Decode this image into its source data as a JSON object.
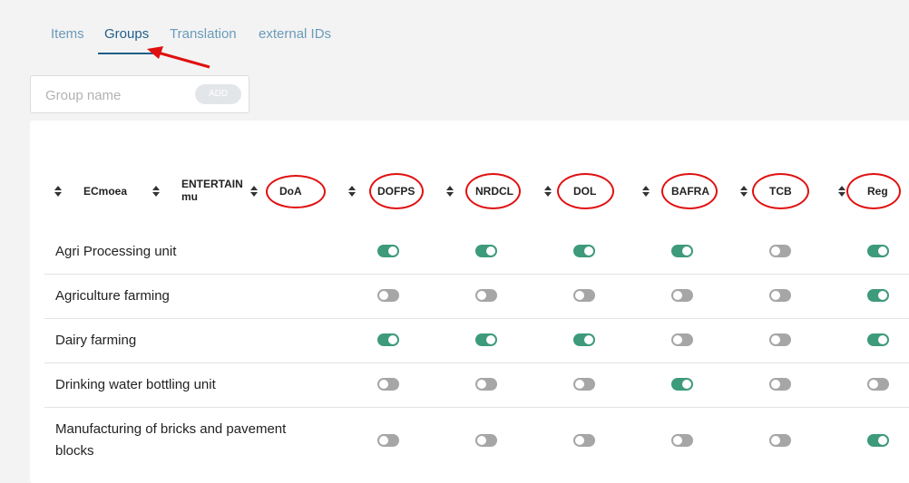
{
  "tabs": [
    {
      "label": "Items"
    },
    {
      "label": "Groups"
    },
    {
      "label": "Translation"
    },
    {
      "label": "external IDs"
    }
  ],
  "active_tab": "Groups",
  "group_form": {
    "placeholder": "Group name",
    "value": "",
    "add_label": "ADD"
  },
  "columns": [
    {
      "label": "ECmoea"
    },
    {
      "label": "ENTERTAIN mu",
      "line1": "ENTERTAIN",
      "line2": "mu"
    },
    {
      "label": "DoA"
    },
    {
      "label": "DOFPS"
    },
    {
      "label": "NRDCL"
    },
    {
      "label": "DOL"
    },
    {
      "label": "BAFRA"
    },
    {
      "label": "TCB"
    },
    {
      "label": "Reg"
    }
  ],
  "rows": [
    {
      "label": "Agri Processing unit",
      "toggles": [
        true,
        true,
        true,
        true,
        false,
        true
      ]
    },
    {
      "label": "Agriculture farming",
      "toggles": [
        false,
        false,
        false,
        false,
        false,
        true
      ]
    },
    {
      "label": "Dairy farming",
      "toggles": [
        true,
        true,
        true,
        false,
        false,
        true
      ]
    },
    {
      "label": "Drinking water bottling unit",
      "toggles": [
        false,
        false,
        false,
        true,
        false,
        false
      ]
    },
    {
      "label": "Manufacturing of bricks and pavement blocks",
      "line1": "Manufacturing of bricks and pavement",
      "line2": "blocks",
      "toggles": [
        false,
        false,
        false,
        false,
        false,
        true
      ]
    }
  ],
  "colors": {
    "toggle_on": "#3d9a7a",
    "toggle_off": "#a6a6a6",
    "annotation": "#e01010",
    "tab_active": "#1f5f8a",
    "tab_inactive": "#6a9bb9"
  }
}
